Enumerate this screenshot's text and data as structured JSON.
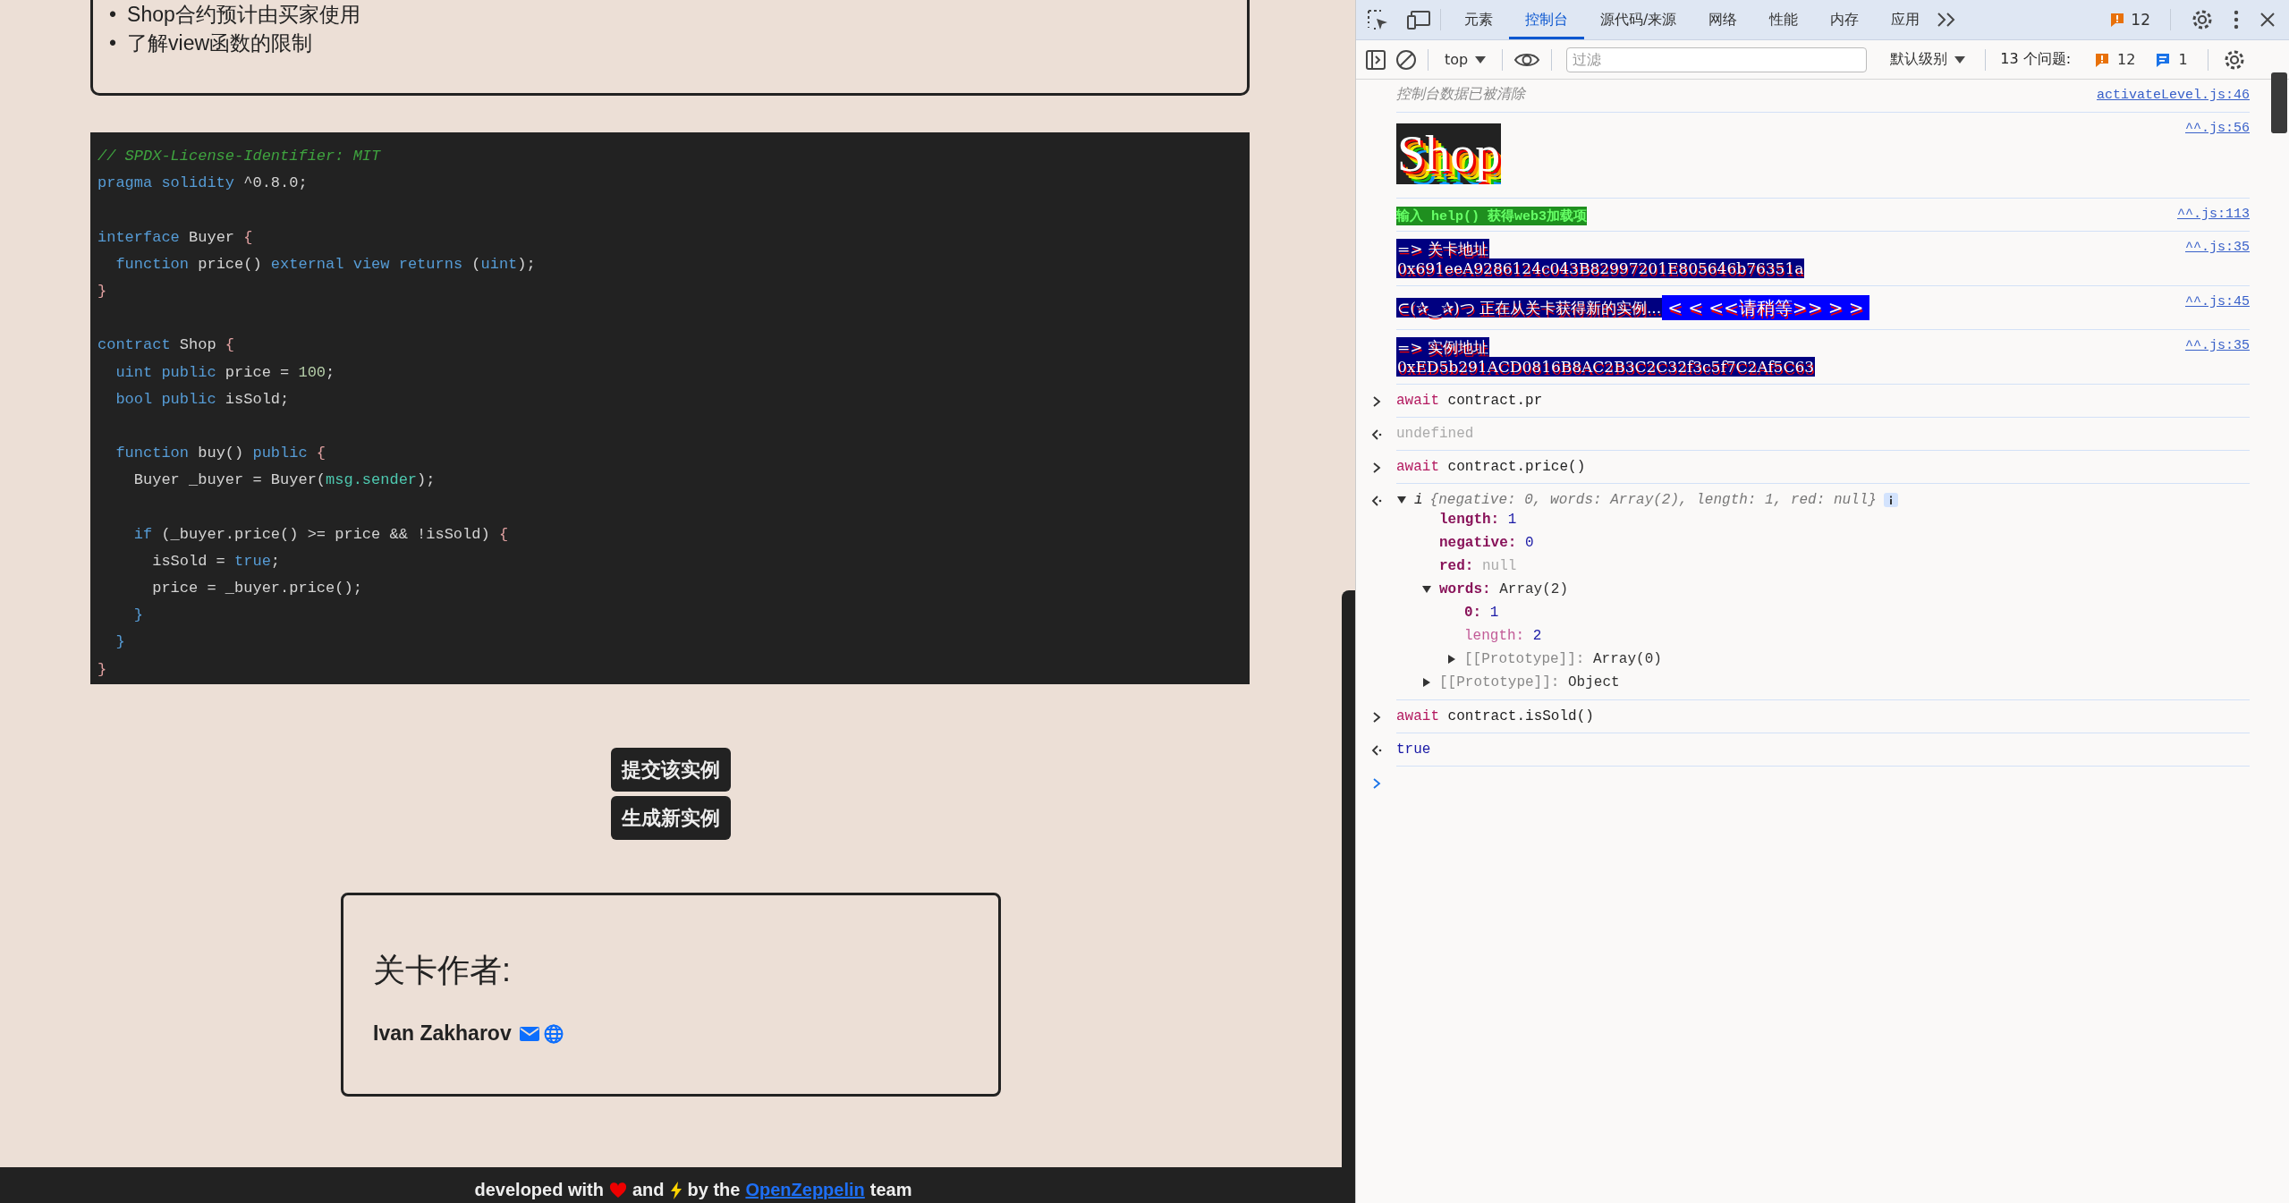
{
  "page": {
    "goals": [
      {
        "bullet": "•",
        "text": "Shop合约预计由买家使用"
      },
      {
        "bullet": "•",
        "text": "了解view函数的限制"
      }
    ],
    "code": [
      {
        "kind": "code",
        "tokens": [
          {
            "kind": "comment",
            "text": "// SPDX-License-Identifier: MIT"
          }
        ]
      },
      {
        "kind": "code",
        "tokens": [
          {
            "kind": "kw",
            "text": "pragma solidity"
          },
          {
            "kind": "plain",
            "text": " ^0.8.0;"
          }
        ]
      },
      {
        "kind": "blank"
      },
      {
        "kind": "code",
        "tokens": [
          {
            "kind": "kw",
            "text": "interface"
          },
          {
            "kind": "plain",
            "text": " Buyer "
          },
          {
            "kind": "brace",
            "text": "{"
          }
        ]
      },
      {
        "kind": "code",
        "tokens": [
          {
            "kind": "kw",
            "text": "  function"
          },
          {
            "kind": "plain",
            "text": " price() "
          },
          {
            "kind": "kw",
            "text": "external view returns"
          },
          {
            "kind": "plain",
            "text": " ("
          },
          {
            "kind": "kw",
            "text": "uint"
          },
          {
            "kind": "plain",
            "text": ");"
          }
        ]
      },
      {
        "kind": "code",
        "tokens": [
          {
            "kind": "brace",
            "text": "}"
          }
        ]
      },
      {
        "kind": "blank"
      },
      {
        "kind": "code",
        "tokens": [
          {
            "kind": "kw",
            "text": "contract"
          },
          {
            "kind": "plain",
            "text": " Shop "
          },
          {
            "kind": "brace",
            "text": "{"
          }
        ]
      },
      {
        "kind": "code",
        "tokens": [
          {
            "kind": "kw",
            "text": "  uint public"
          },
          {
            "kind": "plain",
            "text": " price = "
          },
          {
            "kind": "num",
            "text": "100"
          },
          {
            "kind": "plain",
            "text": ";"
          }
        ]
      },
      {
        "kind": "code",
        "tokens": [
          {
            "kind": "kw",
            "text": "  bool public"
          },
          {
            "kind": "plain",
            "text": " isSold;"
          }
        ]
      },
      {
        "kind": "blank"
      },
      {
        "kind": "code",
        "tokens": [
          {
            "kind": "kw",
            "text": "  function"
          },
          {
            "kind": "plain",
            "text": " buy() "
          },
          {
            "kind": "kw",
            "text": "public"
          },
          {
            "kind": "brace",
            "text": " {"
          }
        ]
      },
      {
        "kind": "code",
        "tokens": [
          {
            "kind": "plain",
            "text": "    Buyer _buyer = Buyer("
          },
          {
            "kind": "builtin",
            "text": "msg.sender"
          },
          {
            "kind": "plain",
            "text": ");"
          }
        ]
      },
      {
        "kind": "blank"
      },
      {
        "kind": "code",
        "tokens": [
          {
            "kind": "kw",
            "text": "    if"
          },
          {
            "kind": "plain",
            "text": " (_buyer.price() >= price && !isSold) "
          },
          {
            "kind": "brace",
            "text": "{"
          }
        ]
      },
      {
        "kind": "code",
        "tokens": [
          {
            "kind": "plain",
            "text": "      isSold = "
          },
          {
            "kind": "kw",
            "text": "true"
          },
          {
            "kind": "plain",
            "text": ";"
          }
        ]
      },
      {
        "kind": "code",
        "tokens": [
          {
            "kind": "plain",
            "text": "      price = _buyer.price();"
          }
        ]
      },
      {
        "kind": "code",
        "tokens": [
          {
            "kind": "kw",
            "text": "    }"
          }
        ]
      },
      {
        "kind": "code",
        "tokens": [
          {
            "kind": "kw",
            "text": "  }"
          }
        ]
      },
      {
        "kind": "code",
        "tokens": [
          {
            "kind": "brace",
            "text": "}"
          }
        ]
      }
    ],
    "buttons": [
      "提交该实例",
      "生成新实例"
    ],
    "author": {
      "heading": "关卡作者:",
      "name": "Ivan Zakharov"
    },
    "footer": {
      "before": "developed with",
      "middle": "and",
      "after": "by the",
      "link": "OpenZeppelin",
      "end": "team"
    }
  },
  "devtools": {
    "tabs": [
      {
        "label": "元素",
        "selected": false
      },
      {
        "label": "控制台",
        "selected": true
      },
      {
        "label": "源代码/来源",
        "selected": false
      },
      {
        "label": "网络",
        "selected": false
      },
      {
        "label": "性能",
        "selected": false
      },
      {
        "label": "内存",
        "selected": false
      },
      {
        "label": "应用",
        "selected": false
      }
    ],
    "issue_count": "12",
    "context": "top",
    "filter_placeholder": "过滤",
    "log_level": "默认级别",
    "issues_label": "13 个问题:",
    "warnings": "12",
    "infos": "1",
    "console": [
      {
        "kind": "cleared",
        "text": "控制台数据已被清除",
        "source": "activateLevel.js:46"
      },
      {
        "kind": "banner",
        "text": "Shop",
        "source": "^^.js:56"
      },
      {
        "kind": "hint",
        "text": "输入 help() 获得web3加载项",
        "source": "^^.js:113"
      },
      {
        "kind": "address",
        "lines": [
          "=> 关卡地址",
          "0x691eeA9286124c043B82997201E805646b76351a"
        ],
        "source": "^^.js:35"
      },
      {
        "kind": "loading",
        "text": "⊂(✰‿✰)つ 正在从关卡获得新的实例...",
        "wait": "< < <<请稍等>> > >",
        "source": "^^.js:45"
      },
      {
        "kind": "address",
        "lines": [
          "=> 实例地址",
          "0xED5b291ACD0816B8AC2B3C2C32f3c5f7C2Af5C63"
        ],
        "source": "^^.js:35"
      },
      {
        "kind": "input",
        "keyword": "await",
        "text": "contract.pr"
      },
      {
        "kind": "undefined",
        "text": "undefined"
      },
      {
        "kind": "input",
        "keyword": "await",
        "text": "contract.price()"
      },
      {
        "kind": "object",
        "label": "i",
        "preview": "{negative: 0, words: Array(2), length: 1, red: null}",
        "expanded": true,
        "properties": [
          {
            "key": "length:",
            "value": "1",
            "kind": "number"
          },
          {
            "key": "negative:",
            "value": "0",
            "kind": "number"
          },
          {
            "key": "red:",
            "value": "null",
            "kind": "null"
          },
          {
            "key": "words:",
            "value": "Array(2)",
            "kind": "object",
            "expanded": true,
            "children": [
              {
                "key": "0:",
                "value": "1",
                "kind": "number"
              },
              {
                "key": "length:",
                "value": "2",
                "kind": "number",
                "hidden": true
              },
              {
                "key": "[[Prototype]]:",
                "value": "Array(0)",
                "kind": "object",
                "internal": true,
                "expanded": false
              }
            ]
          },
          {
            "key": "[[Prototype]]:",
            "value": "Object",
            "kind": "object",
            "internal": true,
            "expanded": false
          }
        ]
      },
      {
        "kind": "input",
        "keyword": "await",
        "text": "contract.isSold()"
      },
      {
        "kind": "boolean",
        "text": "true"
      }
    ]
  }
}
